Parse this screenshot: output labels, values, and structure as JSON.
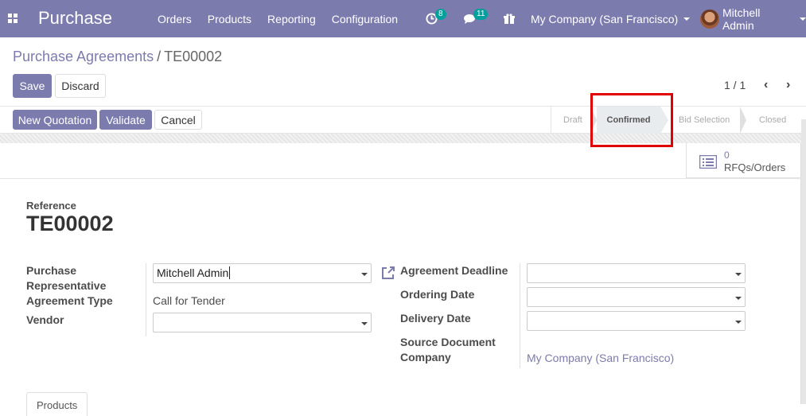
{
  "navbar": {
    "app_title": "Purchase",
    "menu": [
      "Orders",
      "Products",
      "Reporting",
      "Configuration"
    ],
    "activity_count": "8",
    "messages_count": "11",
    "company": "My Company (San Francisco)",
    "user": "Mitchell Admin",
    "color": "#7c7bad"
  },
  "breadcrumb": {
    "parent": "Purchase Agreements",
    "separator": "/",
    "current": "TE00002"
  },
  "control": {
    "save": "Save",
    "discard": "Discard",
    "pager": "1 / 1"
  },
  "header_buttons": {
    "new_quotation": "New Quotation",
    "validate": "Validate",
    "cancel": "Cancel"
  },
  "status": {
    "stages": [
      "Draft",
      "Confirmed",
      "Bid Selection",
      "Closed"
    ],
    "active": "Confirmed"
  },
  "smart_button": {
    "count": "0",
    "label": "RFQs/Orders"
  },
  "form": {
    "reference_label": "Reference",
    "reference": "TE00002",
    "purchase_rep_label_1": "Purchase",
    "purchase_rep_label_2": "Representative",
    "purchase_rep_value": "Mitchell Admin",
    "agreement_type_label": "Agreement Type",
    "agreement_type_value": "Call for Tender",
    "vendor_label": "Vendor",
    "vendor_value": "",
    "agreement_deadline_label": "Agreement Deadline",
    "ordering_date_label": "Ordering Date",
    "delivery_date_label": "Delivery Date",
    "source_document_label": "Source Document",
    "company_label": "Company",
    "company_value": "My Company (San Francisco)"
  },
  "tabs": {
    "products": "Products"
  }
}
